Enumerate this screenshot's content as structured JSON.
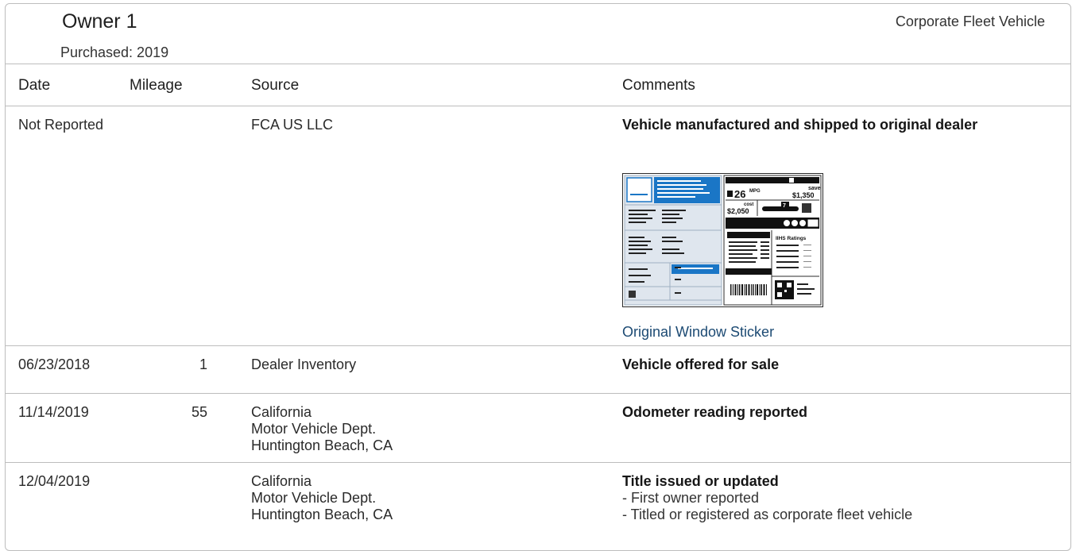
{
  "owner": {
    "title": "Owner 1",
    "purchased": "Purchased: 2019",
    "type": "Corporate Fleet Vehicle"
  },
  "columns": {
    "date": "Date",
    "mileage": "Mileage",
    "source": "Source",
    "comments": "Comments"
  },
  "rows": [
    {
      "date": "Not Reported",
      "mileage": "",
      "source": [
        "FCA US LLC"
      ],
      "headline": "Vehicle manufactured and shipped to original dealer",
      "details": [],
      "link": "Original Window Sticker"
    },
    {
      "date": "06/23/2018",
      "mileage": "1",
      "source": [
        "Dealer Inventory"
      ],
      "headline": "Vehicle offered for sale",
      "details": []
    },
    {
      "date": "11/14/2019",
      "mileage": "55",
      "source": [
        "California",
        "Motor Vehicle Dept.",
        "Huntington Beach, CA"
      ],
      "headline": "Odometer reading reported",
      "details": []
    },
    {
      "date": "12/04/2019",
      "mileage": "",
      "source": [
        "California",
        "Motor Vehicle Dept.",
        "Huntington Beach, CA"
      ],
      "headline": "Title issued or updated",
      "details": [
        "- First owner reported",
        "- Titled or registered as corporate fleet vehicle"
      ]
    }
  ],
  "sticker": {
    "mpg": "26",
    "mpg_unit": "MPG",
    "save_label": "save",
    "save_amount": "$1,350",
    "cost_label": "cost",
    "cost_amount": "$2,050",
    "ratings_label": "IIHS Ratings",
    "rating_value": "7"
  },
  "colors": {
    "border": "#bdbdbd",
    "link": "#1c4a73",
    "sticker_blue": "#1a76c6",
    "sticker_panel": "#dfe6ee"
  }
}
